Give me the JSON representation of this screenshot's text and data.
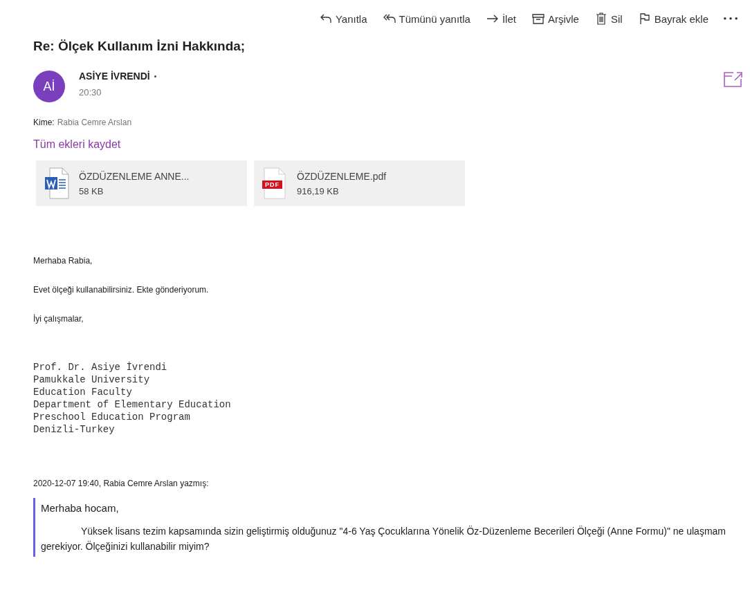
{
  "toolbar": [
    {
      "kind": "reply",
      "label": "Yanıtla"
    },
    {
      "kind": "reply-all",
      "label": "Tümünü yanıtla"
    },
    {
      "kind": "forward",
      "label": "İlet"
    },
    {
      "kind": "archive",
      "label": "Arşivle"
    },
    {
      "kind": "delete",
      "label": "Sil"
    },
    {
      "kind": "flag",
      "label": "Bayrak ekle"
    },
    {
      "kind": "more"
    }
  ],
  "subject": "Re: Ölçek Kullanım İzni Hakkında;",
  "sender": {
    "initials": "Aİ",
    "name": "ASİYE İVRENDİ",
    "time": "20:30"
  },
  "to": {
    "label": "Kime:",
    "value": "Rabia Cemre Arslan"
  },
  "save_all": "Tüm ekleri kaydet",
  "attachments": [
    {
      "kind": "word",
      "name": "ÖZDÜZENLEME ANNE...",
      "size": "58 KB"
    },
    {
      "kind": "pdf",
      "name": "ÖZDÜZENLEME.pdf",
      "size": "916,19 KB",
      "badge": "PDF"
    }
  ],
  "body": [
    "Merhaba Rabia,",
    "Evet ölçeği kullanabilirsiniz. Ekte gönderiyorum.",
    "İyi çalışmalar,"
  ],
  "signature": [
    "Prof. Dr. Asiye İvrendi",
    "Pamukkale University",
    "Education Faculty",
    "Department of Elementary Education",
    "Preschool Education Program",
    "Denizli-Turkey"
  ],
  "quote_header": "2020-12-07 19:40, Rabia Cemre Arslan yazmış:",
  "quote": {
    "greeting": "Merhaba hocam,",
    "text": "Yüksek lisans tezim kapsamında sizin geliştirmiş olduğunuz  \"4-6 Yaş Çocuklarına Yönelik Öz-Düzenleme Becerileri Ölçeği (Anne Formu)\" ne ulaşmam gerekiyor. Ölçeğinizi kullanabilir miyim?"
  }
}
